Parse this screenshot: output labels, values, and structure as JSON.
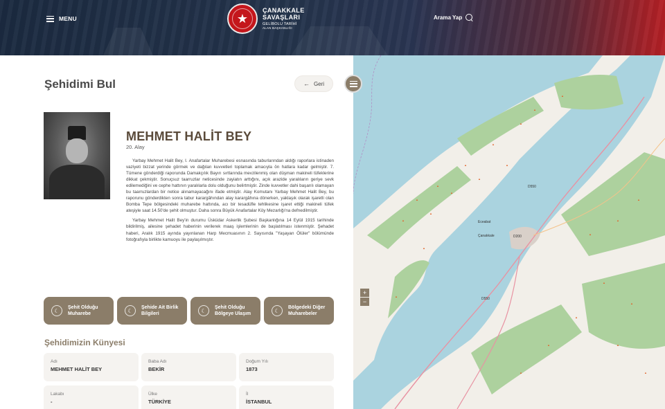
{
  "header": {
    "menu_label": "MENU",
    "logo": {
      "line1": "ÇANAKKALE",
      "line2": "SAVAŞLARI",
      "line3": "GELİBOLU TARİHİ",
      "line4": "ALAN BAŞKANLIĞI"
    },
    "search_label": "Arama Yap"
  },
  "page": {
    "title": "Şehidimi Bul",
    "back_label": "Geri"
  },
  "martyr": {
    "name": "MEHMET HALİT BEY",
    "unit": "20. Alay",
    "bio": [
      "Yarbay Mehmet Halit Bey, I. Anafartalar Muharebesi esnasında taburlarından aldığı raporlara istinaden vaziyeti bizzat yerinde görmek ve dağılan kuvvetleri toplamak amacıyla ön hatlara kadar gelmiştir. 7. Tümene gönderdiği raporunda Damakçılık Bayırı sırtlarında mevzilenmiş olan düşman makineli tüfeklerine dikkat çekmiştir. Sonuçsuz taarruzlar neticesinde zayiatın arttığını, açık arazide yaralıların geriye sevk edilemediğini ve cephe hattının yaralılarla dolu olduğunu belirtmiştir. Zinde kuvvetler dahi başarılı olamayan bu taarruzlardan bir netice alınamayacağını ifade etmiştir. Alay Komutanı Yarbay Mehmet Halit Bey, bu raporunu gönderdikten sonra tabur karargâhından alay karargâhına dönerken, yaklaşık olarak işaretli olan Bomba Tepe bölgesindeki muharebe hattında, acı bir tesadüfle tehlikesine işaret ettiği makineli tüfek ateşiyle saat 14.50'de şehit olmuştur. Daha sonra Büyük Anafartalar Köy Mezarlığı'na defnedilmiştir.",
      "Yarbay Mehmet Halit Bey'in durumu Üsküdar Askerlik Şubesi Başkanlığına 14 Eylül 1915 tarihinde bildirilmiş, ailesine şehadet haberinin verilerek maaş işlemlerinin de başlatılması istenmiştir. Şehadet haberi, Aralık 1915 ayında yayınlanan Harp Mecmuasının 2. Sayısında \"Yaşayan Ölüler\" bölümünde fotoğrafıyla birlikte kamuoyu ile paylaşılmıştır."
    ]
  },
  "cards": [
    {
      "label1": "Şehit Olduğu",
      "label2": "Muharebe"
    },
    {
      "label1": "Şehide Ait Birlik",
      "label2": "Bilgileri"
    },
    {
      "label1": "Şehit Olduğu",
      "label2": "Bölgeye Ulaşım"
    },
    {
      "label1": "Bölgedeki Diğer",
      "label2": "Muharebeler"
    }
  ],
  "kunye": {
    "title": "Şehidimizin Künyesi",
    "fields": [
      {
        "key": "Adı",
        "value": "MEHMET HALİT BEY"
      },
      {
        "key": "Baba Adı",
        "value": "BEKİR"
      },
      {
        "key": "Doğum Yılı",
        "value": "1873"
      },
      {
        "key": "Lakabı",
        "value": "-"
      },
      {
        "key": "Ülke",
        "value": "TÜRKİYE"
      },
      {
        "key": "İl",
        "value": "İSTANBUL"
      }
    ]
  },
  "map": {
    "labels": {
      "city": "Çanakkale",
      "town": "Eceabat",
      "road1": "D550",
      "road2": "D200",
      "road3": "D550"
    },
    "zoom_in": "+",
    "zoom_out": "−"
  },
  "colors": {
    "accent": "#8b7d69",
    "brand_red": "#c4161c",
    "sea": "#aad3df",
    "land": "#f2efe9",
    "forest": "#add19e"
  }
}
